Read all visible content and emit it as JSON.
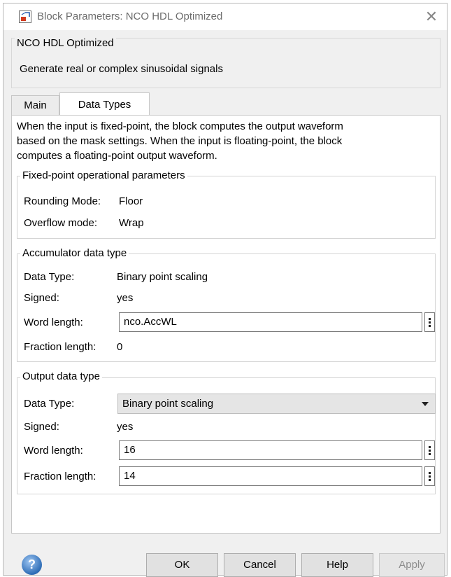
{
  "window": {
    "title": "Block Parameters: NCO HDL Optimized"
  },
  "header": {
    "block_name": "NCO HDL Optimized",
    "description": "Generate real or complex sinusoidal signals"
  },
  "tabs": [
    {
      "label": "Main",
      "active": false
    },
    {
      "label": "Data Types",
      "active": true
    }
  ],
  "content": {
    "info_line1": "When the input is fixed-point, the block computes the output waveform",
    "info_line2": "based on the mask settings. When the input is floating-point, the block",
    "info_line3": "computes a floating-point output waveform.",
    "fixed_point": {
      "title": "Fixed-point operational parameters",
      "rounding_label": "Rounding Mode:",
      "rounding_value": "Floor",
      "overflow_label": "Overflow mode:",
      "overflow_value": "Wrap"
    },
    "accumulator": {
      "title": "Accumulator data type",
      "data_type_label": "Data Type:",
      "data_type_value": "Binary point scaling",
      "signed_label": "Signed:",
      "signed_value": "yes",
      "word_length_label": "Word length:",
      "word_length_value": "nco.AccWL",
      "fraction_length_label": "Fraction length:",
      "fraction_length_value": "0"
    },
    "output": {
      "title": "Output data type",
      "data_type_label": "Data Type:",
      "data_type_value": "Binary point scaling",
      "signed_label": "Signed:",
      "signed_value": "yes",
      "word_length_label": "Word length:",
      "word_length_value": "16",
      "fraction_length_label": "Fraction length:",
      "fraction_length_value": "14"
    }
  },
  "buttons": {
    "ok": "OK",
    "cancel": "Cancel",
    "help": "Help",
    "apply": "Apply",
    "help_icon_glyph": "?"
  },
  "icons": {
    "app": "simulink-block-icon",
    "close": "close-icon",
    "help": "help-icon",
    "dropdown": "chevron-down-icon",
    "ellipsis": "vertical-ellipsis-icon"
  }
}
